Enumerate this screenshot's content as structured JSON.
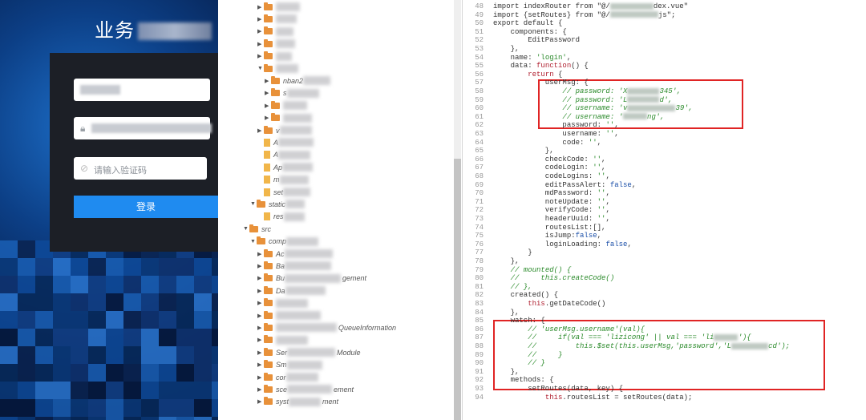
{
  "login": {
    "title": "业务",
    "captcha_placeholder": "请输入验证码",
    "login_button": "登录",
    "icons": [
      "user-icon",
      "lock-icon",
      "shield-icon"
    ]
  },
  "tree": {
    "rows": [
      {
        "indent": 3,
        "arrow": "▶",
        "type": "folder",
        "label": "",
        "blur": 30
      },
      {
        "indent": 3,
        "arrow": "▶",
        "type": "folder",
        "label": "",
        "blur": 26
      },
      {
        "indent": 3,
        "arrow": "▶",
        "type": "folder",
        "label": "",
        "blur": 22
      },
      {
        "indent": 3,
        "arrow": "▶",
        "type": "folder",
        "label": "",
        "blur": 24
      },
      {
        "indent": 3,
        "arrow": "▶",
        "type": "folder",
        "label": "",
        "blur": 20
      },
      {
        "indent": 3,
        "arrow": "▼",
        "type": "folder",
        "label": "",
        "blur": 28
      },
      {
        "indent": 4,
        "arrow": "▶",
        "type": "folder",
        "label": "nban2",
        "blur": 34
      },
      {
        "indent": 4,
        "arrow": "▶",
        "type": "folder",
        "label": "s",
        "blur": 40
      },
      {
        "indent": 4,
        "arrow": "▶",
        "type": "folder",
        "label": "",
        "blur": 30
      },
      {
        "indent": 4,
        "arrow": "▶",
        "type": "folder",
        "label": "",
        "blur": 36
      },
      {
        "indent": 3,
        "arrow": "▶",
        "type": "folder",
        "label": "v",
        "blur": 40
      },
      {
        "indent": 3,
        "arrow": "",
        "type": "file",
        "label": "A",
        "blur": 44
      },
      {
        "indent": 3,
        "arrow": "",
        "type": "file",
        "label": "A",
        "blur": 40
      },
      {
        "indent": 3,
        "arrow": "",
        "type": "file",
        "label": "Ap",
        "blur": 38
      },
      {
        "indent": 3,
        "arrow": "",
        "type": "file",
        "label": "m",
        "blur": 36
      },
      {
        "indent": 3,
        "arrow": "",
        "type": "file",
        "label": "set",
        "blur": 34
      },
      {
        "indent": 2,
        "arrow": "▼",
        "type": "folder",
        "label": "static",
        "blur": 24
      },
      {
        "indent": 3,
        "arrow": "",
        "type": "file",
        "label": "res",
        "blur": 26
      },
      {
        "indent": 1,
        "arrow": "▼",
        "type": "folder",
        "label": "src",
        "blur": 0
      },
      {
        "indent": 2,
        "arrow": "▼",
        "type": "folder",
        "label": "comp",
        "blur": 40
      },
      {
        "indent": 3,
        "arrow": "▶",
        "type": "folder",
        "label": "Ac",
        "blur": 60
      },
      {
        "indent": 3,
        "arrow": "▶",
        "type": "folder",
        "label": "Ba",
        "blur": 58
      },
      {
        "indent": 3,
        "arrow": "▶",
        "type": "folder",
        "label": "Bu",
        "blur": 70,
        "suffix": "gement"
      },
      {
        "indent": 3,
        "arrow": "▶",
        "type": "folder",
        "label": "Da",
        "blur": 50
      },
      {
        "indent": 3,
        "arrow": "▶",
        "type": "folder",
        "label": "",
        "blur": 40
      },
      {
        "indent": 3,
        "arrow": "▶",
        "type": "folder",
        "label": "",
        "blur": 56
      },
      {
        "indent": 3,
        "arrow": "▶",
        "type": "folder",
        "label": "",
        "blur": 76,
        "suffix": "QueueInformation"
      },
      {
        "indent": 3,
        "arrow": "▶",
        "type": "folder",
        "label": "",
        "blur": 40
      },
      {
        "indent": 3,
        "arrow": "▶",
        "type": "folder",
        "label": "Ser",
        "blur": 60,
        "suffix": "Module"
      },
      {
        "indent": 3,
        "arrow": "▶",
        "type": "folder",
        "label": "Sm",
        "blur": 44
      },
      {
        "indent": 3,
        "arrow": "▶",
        "type": "folder",
        "label": "cor",
        "blur": 40
      },
      {
        "indent": 3,
        "arrow": "▶",
        "type": "folder",
        "label": "sce",
        "blur": 56,
        "suffix": "ement"
      },
      {
        "indent": 3,
        "arrow": "▶",
        "type": "folder",
        "label": "syst",
        "blur": 40,
        "suffix": "ment"
      }
    ]
  },
  "code": {
    "lines": [
      {
        "n": "48",
        "html": "import indexRouter from \"@/<B54>dex.vue\""
      },
      {
        "n": "49",
        "html": "import {setRoutes} from \"@/<B60>js\";"
      },
      {
        "n": "50",
        "html": "export default {"
      },
      {
        "n": "51",
        "html": "    components: {"
      },
      {
        "n": "52",
        "html": "        EditPassword"
      },
      {
        "n": "53",
        "html": "    },"
      },
      {
        "n": "54",
        "html": "    name: <s>'login'</s>,"
      },
      {
        "n": "55",
        "html": "    data: <k>function</k>() {"
      },
      {
        "n": "56",
        "html": "        <k>return</k> {"
      },
      {
        "n": "57",
        "html": "            userMsg: {"
      },
      {
        "n": "58",
        "html": "                <c>// password: 'X</c><B40><c>345',</c>"
      },
      {
        "n": "59",
        "html": "                <c>// password: 'L</c><B40><c>d',</c>"
      },
      {
        "n": "60",
        "html": "                <c>// username: 'v</c><B60><c>39',</c>"
      },
      {
        "n": "61",
        "html": "                <c>// username: '</c><B30><c>ng',</c>"
      },
      {
        "n": "62",
        "html": "                password: <s>''</s>,"
      },
      {
        "n": "63",
        "html": "                username: <s>''</s>,"
      },
      {
        "n": "64",
        "html": "                code: <s>''</s>,"
      },
      {
        "n": "65",
        "html": "            },"
      },
      {
        "n": "66",
        "html": "            checkCode: <s>''</s>,"
      },
      {
        "n": "67",
        "html": "            codeLogin: <s>''</s>,"
      },
      {
        "n": "68",
        "html": "            codeLogins: <s>''</s>,"
      },
      {
        "n": "69",
        "html": "            editPassAlert: <n>false</n>,"
      },
      {
        "n": "70",
        "html": "            mdPassword: <s>''</s>,"
      },
      {
        "n": "71",
        "html": "            noteUpdate: <s>''</s>,"
      },
      {
        "n": "72",
        "html": "            verifyCode: <s>''</s>,"
      },
      {
        "n": "73",
        "html": "            headerUuid: <s>''</s>,"
      },
      {
        "n": "74",
        "html": "            routesList:[],"
      },
      {
        "n": "75",
        "html": "            isJump:<n>false</n>,"
      },
      {
        "n": "76",
        "html": "            loginLoading: <n>false</n>,"
      },
      {
        "n": "77",
        "html": "        }"
      },
      {
        "n": "78",
        "html": "    },"
      },
      {
        "n": "79",
        "html": "    <c>// mounted() {</c>"
      },
      {
        "n": "80",
        "html": "    <c>//     this.createCode()</c>"
      },
      {
        "n": "81",
        "html": "    <c>// },</c>"
      },
      {
        "n": "82",
        "html": "    created() {"
      },
      {
        "n": "83",
        "html": "        <k>this</k>.getDateCode()"
      },
      {
        "n": "84",
        "html": "    },"
      },
      {
        "n": "85",
        "html": "    watch: {"
      },
      {
        "n": "86",
        "html": "        <c>// 'userMsg.username'(val){</c>"
      },
      {
        "n": "87",
        "html": "        <c>//     if(val === 'lizicong' || val === 'li</c><B30><c>'){</c>"
      },
      {
        "n": "88",
        "html": "        <c>//         this.$set(this.userMsg,'password','L</c><B46><c>cd');</c>"
      },
      {
        "n": "89",
        "html": "        <c>//     }</c>"
      },
      {
        "n": "90",
        "html": "        <c>// }</c>"
      },
      {
        "n": "91",
        "html": "    },"
      },
      {
        "n": "92",
        "html": "    methods: {"
      },
      {
        "n": "93",
        "html": "        setRoutes(data, key) {"
      },
      {
        "n": "94",
        "html": "            <k>this</k>.routesList = setRoutes(data);"
      }
    ]
  },
  "colors": {
    "highlight_box": "#e02424",
    "login_button": "#1f8bf0",
    "folder": "#e8913a"
  }
}
